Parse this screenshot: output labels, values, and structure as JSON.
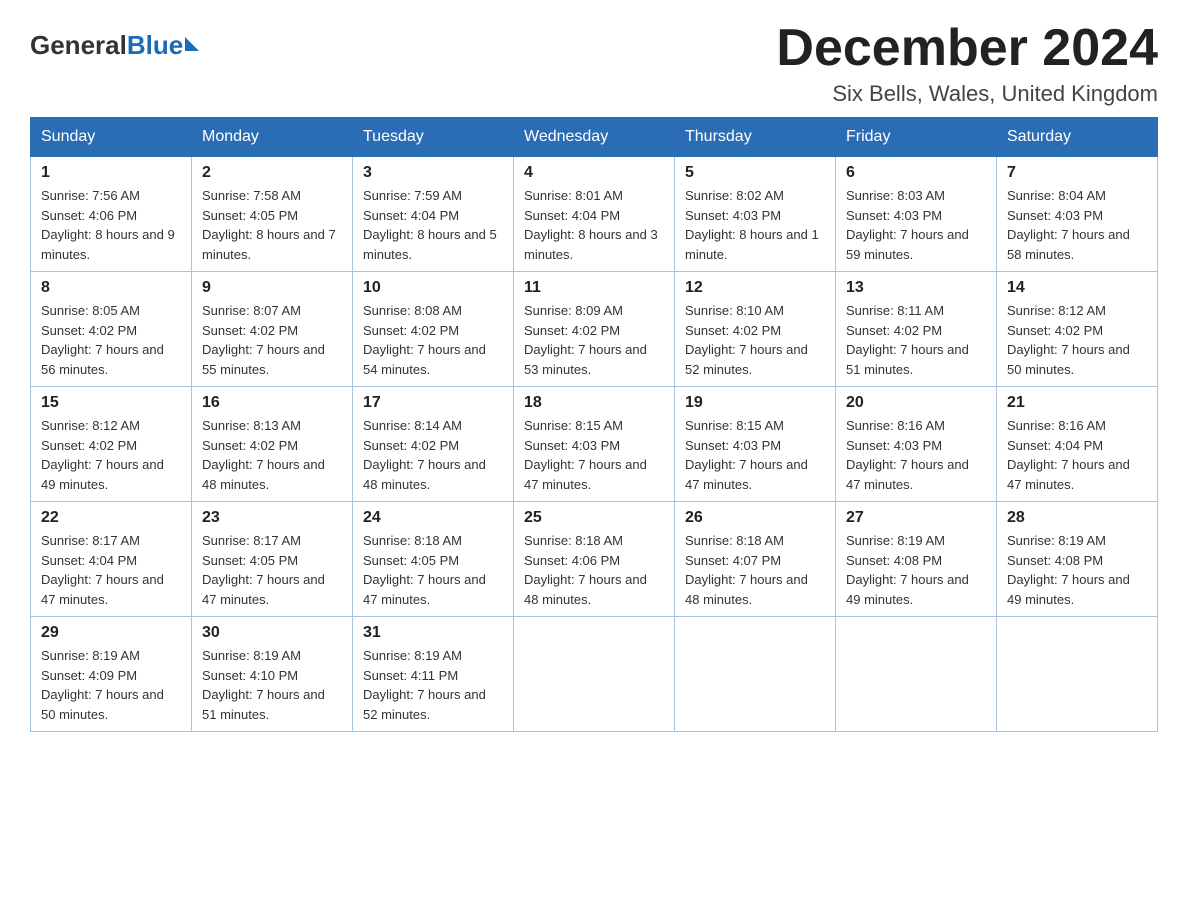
{
  "logo": {
    "general": "General",
    "blue": "Blue"
  },
  "title": "December 2024",
  "location": "Six Bells, Wales, United Kingdom",
  "days_of_week": [
    "Sunday",
    "Monday",
    "Tuesday",
    "Wednesday",
    "Thursday",
    "Friday",
    "Saturday"
  ],
  "weeks": [
    [
      {
        "day": "1",
        "sunrise": "7:56 AM",
        "sunset": "4:06 PM",
        "daylight": "8 hours and 9 minutes."
      },
      {
        "day": "2",
        "sunrise": "7:58 AM",
        "sunset": "4:05 PM",
        "daylight": "8 hours and 7 minutes."
      },
      {
        "day": "3",
        "sunrise": "7:59 AM",
        "sunset": "4:04 PM",
        "daylight": "8 hours and 5 minutes."
      },
      {
        "day": "4",
        "sunrise": "8:01 AM",
        "sunset": "4:04 PM",
        "daylight": "8 hours and 3 minutes."
      },
      {
        "day": "5",
        "sunrise": "8:02 AM",
        "sunset": "4:03 PM",
        "daylight": "8 hours and 1 minute."
      },
      {
        "day": "6",
        "sunrise": "8:03 AM",
        "sunset": "4:03 PM",
        "daylight": "7 hours and 59 minutes."
      },
      {
        "day": "7",
        "sunrise": "8:04 AM",
        "sunset": "4:03 PM",
        "daylight": "7 hours and 58 minutes."
      }
    ],
    [
      {
        "day": "8",
        "sunrise": "8:05 AM",
        "sunset": "4:02 PM",
        "daylight": "7 hours and 56 minutes."
      },
      {
        "day": "9",
        "sunrise": "8:07 AM",
        "sunset": "4:02 PM",
        "daylight": "7 hours and 55 minutes."
      },
      {
        "day": "10",
        "sunrise": "8:08 AM",
        "sunset": "4:02 PM",
        "daylight": "7 hours and 54 minutes."
      },
      {
        "day": "11",
        "sunrise": "8:09 AM",
        "sunset": "4:02 PM",
        "daylight": "7 hours and 53 minutes."
      },
      {
        "day": "12",
        "sunrise": "8:10 AM",
        "sunset": "4:02 PM",
        "daylight": "7 hours and 52 minutes."
      },
      {
        "day": "13",
        "sunrise": "8:11 AM",
        "sunset": "4:02 PM",
        "daylight": "7 hours and 51 minutes."
      },
      {
        "day": "14",
        "sunrise": "8:12 AM",
        "sunset": "4:02 PM",
        "daylight": "7 hours and 50 minutes."
      }
    ],
    [
      {
        "day": "15",
        "sunrise": "8:12 AM",
        "sunset": "4:02 PM",
        "daylight": "7 hours and 49 minutes."
      },
      {
        "day": "16",
        "sunrise": "8:13 AM",
        "sunset": "4:02 PM",
        "daylight": "7 hours and 48 minutes."
      },
      {
        "day": "17",
        "sunrise": "8:14 AM",
        "sunset": "4:02 PM",
        "daylight": "7 hours and 48 minutes."
      },
      {
        "day": "18",
        "sunrise": "8:15 AM",
        "sunset": "4:03 PM",
        "daylight": "7 hours and 47 minutes."
      },
      {
        "day": "19",
        "sunrise": "8:15 AM",
        "sunset": "4:03 PM",
        "daylight": "7 hours and 47 minutes."
      },
      {
        "day": "20",
        "sunrise": "8:16 AM",
        "sunset": "4:03 PM",
        "daylight": "7 hours and 47 minutes."
      },
      {
        "day": "21",
        "sunrise": "8:16 AM",
        "sunset": "4:04 PM",
        "daylight": "7 hours and 47 minutes."
      }
    ],
    [
      {
        "day": "22",
        "sunrise": "8:17 AM",
        "sunset": "4:04 PM",
        "daylight": "7 hours and 47 minutes."
      },
      {
        "day": "23",
        "sunrise": "8:17 AM",
        "sunset": "4:05 PM",
        "daylight": "7 hours and 47 minutes."
      },
      {
        "day": "24",
        "sunrise": "8:18 AM",
        "sunset": "4:05 PM",
        "daylight": "7 hours and 47 minutes."
      },
      {
        "day": "25",
        "sunrise": "8:18 AM",
        "sunset": "4:06 PM",
        "daylight": "7 hours and 48 minutes."
      },
      {
        "day": "26",
        "sunrise": "8:18 AM",
        "sunset": "4:07 PM",
        "daylight": "7 hours and 48 minutes."
      },
      {
        "day": "27",
        "sunrise": "8:19 AM",
        "sunset": "4:08 PM",
        "daylight": "7 hours and 49 minutes."
      },
      {
        "day": "28",
        "sunrise": "8:19 AM",
        "sunset": "4:08 PM",
        "daylight": "7 hours and 49 minutes."
      }
    ],
    [
      {
        "day": "29",
        "sunrise": "8:19 AM",
        "sunset": "4:09 PM",
        "daylight": "7 hours and 50 minutes."
      },
      {
        "day": "30",
        "sunrise": "8:19 AM",
        "sunset": "4:10 PM",
        "daylight": "7 hours and 51 minutes."
      },
      {
        "day": "31",
        "sunrise": "8:19 AM",
        "sunset": "4:11 PM",
        "daylight": "7 hours and 52 minutes."
      },
      null,
      null,
      null,
      null
    ]
  ]
}
